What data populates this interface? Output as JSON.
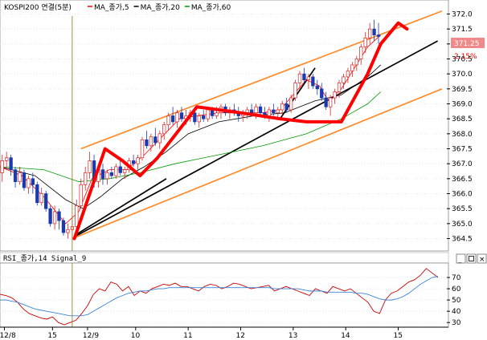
{
  "chart_data": [
    {
      "type": "candlestick",
      "title": "KOSPI200 연결(5분)",
      "legend": [
        {
          "name": "MA_종가,5",
          "color": "#ff0000"
        },
        {
          "name": "MA_종가,20",
          "color": "#000000"
        },
        {
          "name": "MA_종가,60",
          "color": "#009900"
        }
      ],
      "ylim": [
        364.3,
        372.2
      ],
      "y_ticks": [
        "372.0",
        "371.5",
        "371.0",
        "370.5",
        "370.0",
        "369.5",
        "369.0",
        "368.5",
        "368.0",
        "367.5",
        "367.0",
        "366.5",
        "366.0",
        "365.5",
        "365.0",
        "364.5"
      ],
      "last_price": "371.25",
      "change_pct": "2.15%",
      "xlim": [
        0,
        101
      ],
      "x_ticks": [
        {
          "label": "12/8",
          "x": 1
        },
        {
          "label": "15",
          "x": 12
        },
        {
          "label": "12/9",
          "x": 20
        },
        {
          "label": "10",
          "x": 31
        },
        {
          "label": "11",
          "x": 43
        },
        {
          "label": "12",
          "x": 55
        },
        {
          "label": "13",
          "x": 67
        },
        {
          "label": "14",
          "x": 79
        },
        {
          "label": "15",
          "x": 91
        }
      ],
      "day_separator_x": 16.5,
      "candles": [
        [
          366.7,
          367.3,
          366.4,
          367.1
        ],
        [
          367.1,
          367.4,
          366.8,
          367.2
        ],
        [
          367.2,
          367.3,
          366.6,
          366.8
        ],
        [
          366.8,
          366.9,
          366.2,
          366.4
        ],
        [
          366.4,
          366.9,
          366.3,
          366.7
        ],
        [
          366.7,
          366.8,
          366.1,
          366.2
        ],
        [
          366.2,
          366.6,
          366.0,
          366.5
        ],
        [
          366.5,
          366.7,
          366.0,
          366.3
        ],
        [
          366.3,
          366.4,
          365.6,
          365.7
        ],
        [
          365.7,
          366.2,
          365.6,
          366.0
        ],
        [
          366.0,
          366.1,
          365.4,
          365.5
        ],
        [
          365.5,
          365.6,
          364.9,
          365.0
        ],
        [
          365.0,
          365.6,
          364.8,
          365.4
        ],
        [
          365.4,
          365.5,
          364.8,
          365.1
        ],
        [
          365.1,
          365.2,
          364.6,
          364.7
        ],
        [
          364.7,
          365.0,
          364.5,
          364.8
        ],
        [
          364.8,
          365.2,
          364.4,
          364.9
        ],
        [
          364.9,
          365.8,
          364.8,
          365.6
        ],
        [
          365.6,
          366.5,
          365.5,
          366.3
        ],
        [
          366.3,
          366.9,
          366.1,
          366.7
        ],
        [
          366.7,
          367.4,
          366.5,
          367.1
        ],
        [
          367.1,
          367.3,
          366.2,
          366.4
        ],
        [
          366.4,
          366.9,
          366.2,
          366.8
        ],
        [
          366.8,
          367.0,
          366.3,
          366.5
        ],
        [
          366.5,
          366.8,
          366.3,
          366.7
        ],
        [
          366.7,
          366.9,
          366.5,
          366.6
        ],
        [
          366.6,
          367.0,
          366.5,
          366.9
        ],
        [
          366.9,
          367.1,
          366.6,
          366.7
        ],
        [
          366.7,
          366.9,
          366.5,
          366.8
        ],
        [
          366.8,
          367.2,
          366.7,
          367.1
        ],
        [
          367.1,
          367.3,
          366.9,
          367.0
        ],
        [
          367.0,
          367.3,
          366.8,
          367.2
        ],
        [
          367.2,
          367.9,
          367.1,
          367.8
        ],
        [
          367.8,
          368.1,
          367.5,
          367.6
        ],
        [
          367.6,
          368.0,
          367.4,
          367.9
        ],
        [
          367.9,
          368.2,
          367.6,
          367.7
        ],
        [
          367.7,
          368.1,
          367.5,
          368.0
        ],
        [
          368.0,
          368.4,
          367.8,
          368.3
        ],
        [
          368.3,
          368.7,
          368.1,
          368.6
        ],
        [
          368.6,
          368.9,
          368.3,
          368.4
        ],
        [
          368.4,
          368.8,
          368.2,
          368.7
        ],
        [
          368.7,
          368.9,
          368.4,
          368.5
        ],
        [
          368.5,
          368.8,
          368.3,
          368.6
        ],
        [
          368.6,
          368.8,
          368.4,
          368.7
        ],
        [
          368.7,
          368.9,
          368.3,
          368.4
        ],
        [
          368.4,
          368.7,
          368.2,
          368.6
        ],
        [
          368.6,
          368.8,
          368.4,
          368.5
        ],
        [
          368.5,
          368.9,
          368.4,
          368.8
        ],
        [
          368.8,
          368.9,
          368.5,
          368.6
        ],
        [
          368.6,
          368.9,
          368.5,
          368.7
        ],
        [
          368.7,
          369.0,
          368.5,
          368.9
        ],
        [
          368.9,
          369.0,
          368.6,
          368.7
        ],
        [
          368.7,
          368.9,
          368.5,
          368.8
        ],
        [
          368.8,
          369.0,
          368.6,
          368.7
        ],
        [
          368.7,
          368.9,
          368.4,
          368.6
        ],
        [
          368.6,
          368.8,
          368.4,
          368.7
        ],
        [
          368.7,
          368.9,
          368.5,
          368.8
        ],
        [
          368.8,
          369.0,
          368.6,
          368.7
        ],
        [
          368.7,
          369.0,
          368.5,
          368.9
        ],
        [
          368.9,
          369.0,
          368.6,
          368.7
        ],
        [
          368.7,
          368.9,
          368.5,
          368.6
        ],
        [
          368.6,
          368.9,
          368.4,
          368.8
        ],
        [
          368.8,
          369.0,
          368.6,
          368.7
        ],
        [
          368.7,
          368.9,
          368.5,
          368.8
        ],
        [
          368.8,
          369.1,
          368.6,
          369.0
        ],
        [
          369.0,
          369.2,
          368.7,
          368.8
        ],
        [
          368.8,
          369.3,
          368.7,
          369.2
        ],
        [
          369.2,
          369.8,
          369.1,
          369.7
        ],
        [
          369.7,
          370.1,
          369.5,
          370.0
        ],
        [
          370.0,
          370.2,
          369.7,
          369.8
        ],
        [
          369.8,
          370.0,
          369.5,
          369.9
        ],
        [
          369.9,
          370.0,
          369.5,
          369.6
        ],
        [
          369.6,
          369.8,
          369.3,
          369.5
        ],
        [
          369.5,
          369.7,
          369.1,
          369.2
        ],
        [
          369.2,
          369.4,
          368.8,
          368.9
        ],
        [
          368.9,
          369.3,
          368.6,
          369.2
        ],
        [
          369.2,
          369.5,
          369.0,
          369.4
        ],
        [
          369.4,
          369.8,
          369.2,
          369.7
        ],
        [
          369.7,
          370.0,
          369.5,
          369.9
        ],
        [
          369.9,
          370.2,
          369.7,
          370.1
        ],
        [
          370.1,
          370.4,
          369.9,
          370.3
        ],
        [
          370.3,
          370.6,
          370.1,
          370.5
        ],
        [
          370.5,
          371.0,
          370.3,
          370.9
        ],
        [
          370.9,
          371.4,
          370.7,
          371.2
        ],
        [
          371.2,
          371.7,
          371.0,
          371.5
        ],
        [
          371.5,
          371.8,
          371.1,
          371.3
        ],
        [
          371.3,
          371.7,
          371.0,
          371.25
        ]
      ],
      "ma_series": [
        {
          "name": "MA_종가,5",
          "color": "#ff0000",
          "points": [
            [
              0,
              366.9
            ],
            [
              5,
              366.6
            ],
            [
              10,
              365.9
            ],
            [
              15,
              365.0
            ],
            [
              18,
              365.4
            ],
            [
              21,
              366.5
            ],
            [
              25,
              366.8
            ],
            [
              29,
              366.8
            ],
            [
              33,
              367.3
            ],
            [
              37,
              367.9
            ],
            [
              41,
              368.5
            ],
            [
              45,
              368.6
            ],
            [
              50,
              368.7
            ],
            [
              55,
              368.7
            ],
            [
              60,
              368.7
            ],
            [
              64,
              368.8
            ],
            [
              67,
              369.3
            ],
            [
              70,
              369.8
            ],
            [
              73,
              369.6
            ],
            [
              75,
              369.1
            ],
            [
              78,
              369.5
            ],
            [
              81,
              370.2
            ],
            [
              84,
              370.9
            ],
            [
              87,
              371.3
            ]
          ]
        },
        {
          "name": "MA_종가,20",
          "color": "#000000",
          "points": [
            [
              0,
              366.9
            ],
            [
              8,
              366.6
            ],
            [
              15,
              365.8
            ],
            [
              19,
              365.5
            ],
            [
              23,
              365.9
            ],
            [
              28,
              366.5
            ],
            [
              33,
              366.9
            ],
            [
              38,
              367.4
            ],
            [
              43,
              368.0
            ],
            [
              50,
              368.4
            ],
            [
              58,
              368.6
            ],
            [
              65,
              368.7
            ],
            [
              72,
              369.1
            ],
            [
              78,
              369.3
            ],
            [
              84,
              369.9
            ],
            [
              87,
              370.3
            ]
          ]
        },
        {
          "name": "MA_종가,60",
          "color": "#009900",
          "points": [
            [
              0,
              366.9
            ],
            [
              10,
              366.8
            ],
            [
              18,
              366.4
            ],
            [
              25,
              366.5
            ],
            [
              32,
              366.7
            ],
            [
              40,
              367.0
            ],
            [
              50,
              367.3
            ],
            [
              60,
              367.6
            ],
            [
              70,
              368.0
            ],
            [
              78,
              368.5
            ],
            [
              84,
              369.0
            ],
            [
              87,
              369.4
            ]
          ]
        }
      ],
      "trendlines": [
        {
          "color": "#ff8a2a",
          "points": [
            [
              18.5,
              367.5
            ],
            [
              101,
              372.1
            ]
          ]
        },
        {
          "color": "#ff8a2a",
          "points": [
            [
              16.5,
              364.5
            ],
            [
              101,
              369.5
            ]
          ]
        },
        {
          "color": "#000000",
          "points": [
            [
              17.5,
              364.6
            ],
            [
              100,
              371.1
            ]
          ]
        },
        {
          "color": "#000000",
          "points": [
            [
              17,
              364.6
            ],
            [
              38,
              366.5
            ]
          ]
        },
        {
          "color": "#000000",
          "points": [
            [
              64,
              368.5
            ],
            [
              72,
              370.2
            ]
          ]
        }
      ],
      "hand_drawn": {
        "color": "#ff0000",
        "points": [
          [
            17,
            364.5
          ],
          [
            24,
            367.5
          ],
          [
            28,
            367.1
          ],
          [
            32,
            366.6
          ],
          [
            36,
            367.2
          ],
          [
            45,
            368.9
          ],
          [
            55,
            368.7
          ],
          [
            64,
            368.5
          ],
          [
            70,
            368.4
          ],
          [
            78,
            368.4
          ],
          [
            84,
            370.0
          ],
          [
            87,
            371.0
          ],
          [
            91,
            371.7
          ],
          [
            93,
            371.5
          ]
        ]
      }
    },
    {
      "type": "line",
      "title": "RSI_종가,14  Signal_9",
      "ylim": [
        28,
        80
      ],
      "y_ticks": [
        "70",
        "60",
        "50",
        "40",
        "30"
      ],
      "series": [
        {
          "name": "RSI_종가,14",
          "color": "#cc0000",
          "values": [
            55,
            54,
            52,
            48,
            42,
            38,
            36,
            34,
            33,
            35,
            30,
            28,
            30,
            32,
            38,
            45,
            55,
            60,
            58,
            66,
            64,
            58,
            62,
            54,
            58,
            56,
            60,
            62,
            64,
            63,
            65,
            62,
            62,
            60,
            58,
            62,
            64,
            63,
            60,
            62,
            65,
            64,
            62,
            60,
            61,
            62,
            63,
            58,
            60,
            62,
            60,
            58,
            56,
            54,
            60,
            58,
            56,
            62,
            60,
            58,
            60,
            56,
            52,
            48,
            40,
            38,
            50,
            56,
            58,
            62,
            66,
            68,
            72,
            78,
            74,
            70
          ]
        },
        {
          "name": "Signal_9",
          "color": "#3a86d8",
          "values": [
            50,
            50,
            49,
            48,
            46,
            44,
            42,
            41,
            40,
            39,
            38,
            37,
            36,
            36,
            36,
            37,
            40,
            43,
            46,
            49,
            52,
            54,
            56,
            57,
            58,
            58,
            59,
            60,
            60,
            61,
            61,
            61,
            61,
            61,
            61,
            61,
            61,
            61,
            61,
            61,
            61,
            61,
            61,
            61,
            61,
            61,
            61,
            60,
            60,
            60,
            60,
            60,
            59,
            58,
            58,
            58,
            57,
            57,
            57,
            57,
            57,
            56,
            56,
            55,
            53,
            51,
            50,
            50,
            51,
            53,
            56,
            60,
            64,
            67,
            70,
            71
          ]
        }
      ]
    }
  ]
}
